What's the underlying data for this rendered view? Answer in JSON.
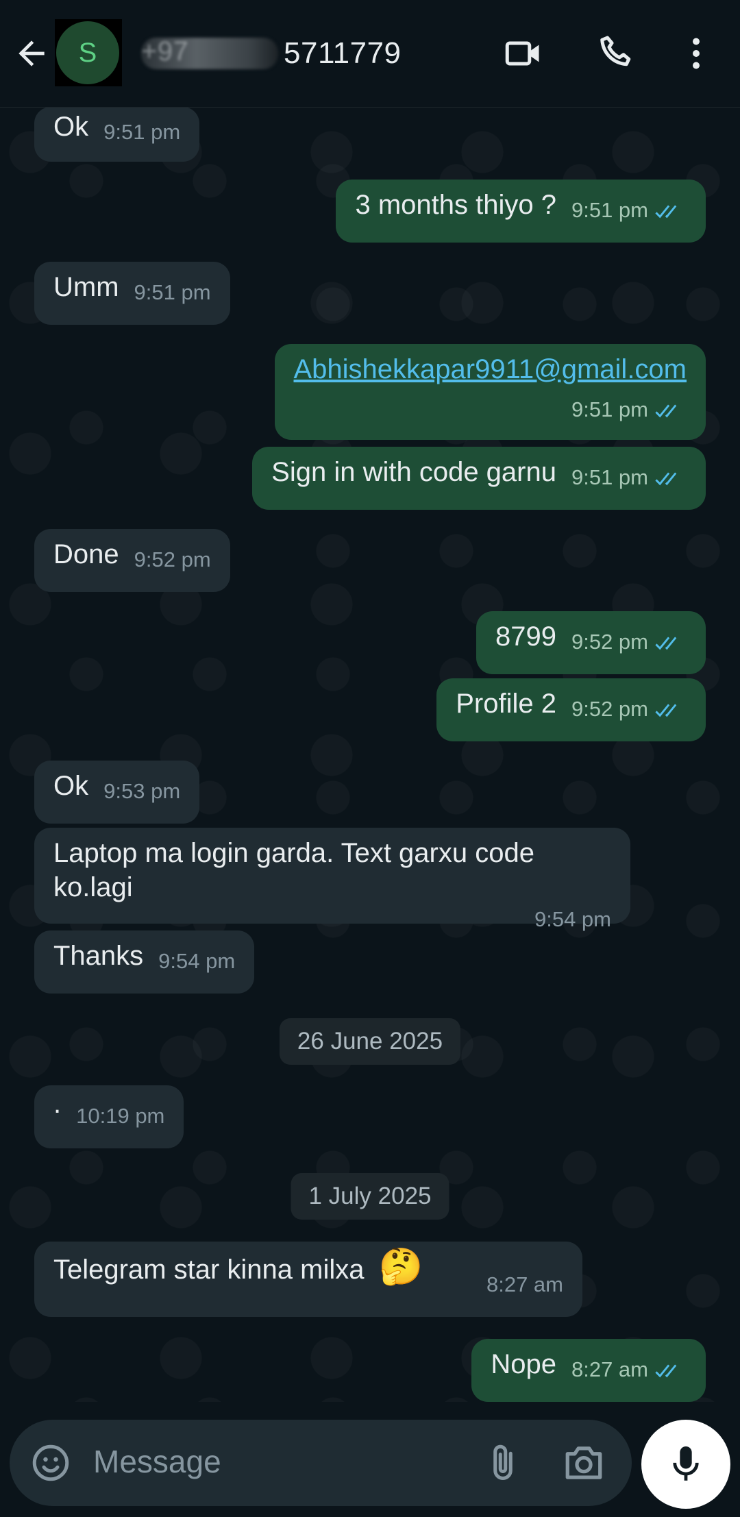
{
  "header": {
    "avatar_letter": "S",
    "contact_prefix": "+97",
    "contact_suffix": "5711779",
    "icons": [
      "back-arrow-icon",
      "video-call-icon",
      "phone-icon",
      "more-vert-icon"
    ]
  },
  "messages": [
    {
      "dir": "in",
      "text": "Ok",
      "time": "9:51 pm"
    },
    {
      "dir": "out",
      "text": "3 months thiyo ?",
      "time": "9:51 pm"
    },
    {
      "dir": "in",
      "text": "Umm",
      "time": "9:51 pm"
    },
    {
      "dir": "out",
      "text": "Abhishekkapar9911@gmail.com",
      "time": "9:51 pm",
      "link": true
    },
    {
      "dir": "out",
      "text": "Sign in with code garnu",
      "time": "9:51 pm"
    },
    {
      "dir": "in",
      "text": "Done",
      "time": "9:52 pm"
    },
    {
      "dir": "out",
      "text": "8799",
      "time": "9:52 pm"
    },
    {
      "dir": "out",
      "text": "Profile 2",
      "time": "9:52 pm"
    },
    {
      "dir": "in",
      "text": "Ok",
      "time": "9:53 pm"
    },
    {
      "dir": "in",
      "text": "Laptop ma login garda. Text garxu code ko.lagi",
      "time": "9:54 pm"
    },
    {
      "dir": "in",
      "text": "Thanks",
      "time": "9:54 pm"
    },
    {
      "dir": "in",
      "text": ".",
      "time": "10:19 pm"
    },
    {
      "dir": "in",
      "text": "Telegram star kinna milxa",
      "emoji": "🤔",
      "time": "8:27 am"
    },
    {
      "dir": "out",
      "text": "Nope",
      "time": "8:27 am"
    }
  ],
  "dates": [
    "26 June 2025",
    "1 July 2025"
  ],
  "composer": {
    "placeholder": "Message"
  },
  "colors": {
    "incoming": "#202c33",
    "outgoing": "#1e4e36",
    "read_ticks": "#53bdeb",
    "link": "#53bdeb"
  }
}
